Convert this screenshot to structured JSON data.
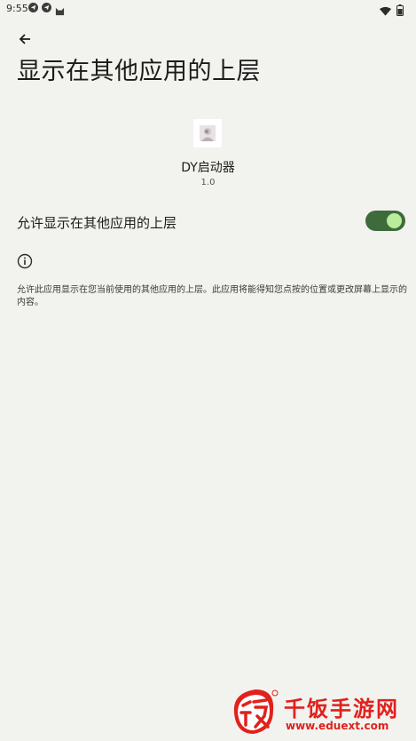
{
  "status_bar": {
    "time": "9:55",
    "left_icons": [
      "telegram-icon",
      "telegram-icon",
      "cat-icon"
    ],
    "right_icons": [
      "wifi-icon",
      "battery-icon"
    ]
  },
  "header": {
    "back_icon": "arrow-left-icon",
    "title": "显示在其他应用的上层"
  },
  "app": {
    "name": "DY启动器",
    "version": "1.0"
  },
  "setting": {
    "label": "允许显示在其他应用的上层",
    "enabled": true,
    "accent_color": "#3e6b3c"
  },
  "info": {
    "icon": "info-icon",
    "text": "允许此应用显示在您当前使用的其他应用的上层。此应用将能得知您点按的位置或更改屏幕上显示的内容。"
  },
  "watermark": {
    "logo_char": "饭",
    "title": "千饭手游网",
    "url": "www.eduext.com",
    "color": "#e0211d"
  }
}
